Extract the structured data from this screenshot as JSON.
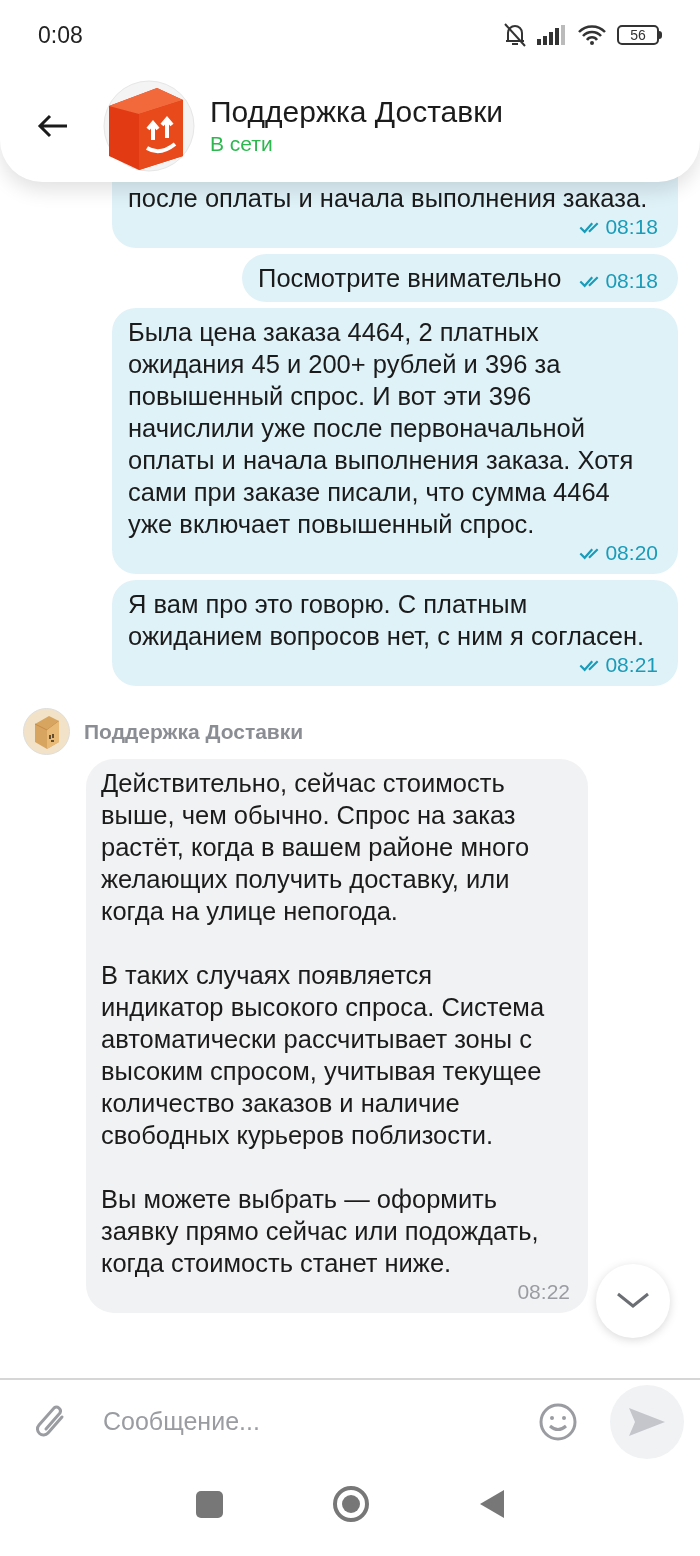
{
  "status_bar": {
    "time": "0:08",
    "battery": "56"
  },
  "header": {
    "title": "Поддержка Доставки",
    "status": "В сети",
    "online": true
  },
  "messages": [
    {
      "kind": "outgoing",
      "text": "после оплаты и начала выполнения заказа.",
      "time": "08:18",
      "read": true
    },
    {
      "kind": "outgoing",
      "text": "Посмотрите внимательно",
      "time": "08:18",
      "read": true
    },
    {
      "kind": "outgoing",
      "text": "Была цена заказа 4464,  2 платных ожидания 45 и 200+ рублей и 396 за повышенный спрос. И вот эти 396 начислили уже после первоначальной оплаты и начала выполнения заказа. Хотя сами при заказе писали, что сумма 4464 уже включает повышенный спрос.",
      "time": "08:20",
      "read": true
    },
    {
      "kind": "outgoing",
      "text": "Я вам про это говорю. С платным ожиданием вопросов нет, с ним я согласен.",
      "time": "08:21",
      "read": true
    },
    {
      "kind": "incoming",
      "sender": "Поддержка Доставки",
      "text": "Действительно, сейчас стоимость выше, чем обычно. Спрос на заказ растёт, когда в вашем районе много желающих получить доставку, или когда на улице непогода.\n\nВ таких случаях появляется индикатор высокого спроса. Система автоматически рассчитывает зоны с высоким спросом, учитывая текущее количество заказов и наличие свободных курьеров поблизости.\n\nВы можете выбрать — оформить заявку прямо сейчас или подождать, когда стоимость станет ниже.",
      "time": "08:22"
    }
  ],
  "composer": {
    "placeholder": "Сообщение..."
  }
}
